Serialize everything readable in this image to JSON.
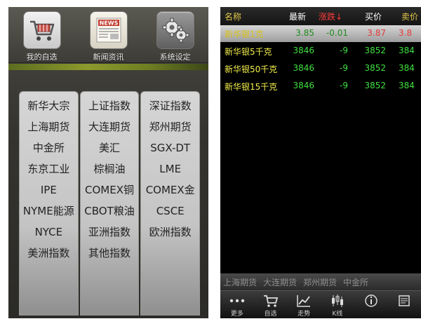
{
  "left": {
    "top_buttons": [
      {
        "label": "我的自选",
        "icon": "shopping-cart-icon"
      },
      {
        "label": "新闻资讯",
        "icon": "newspaper-icon",
        "icon_text": "NEWS"
      },
      {
        "label": "系统设定",
        "icon": "gear-icon"
      }
    ],
    "markets": [
      [
        "新华大宗",
        "上证指数",
        "深证指数"
      ],
      [
        "上海期货",
        "大连期货",
        "郑州期货"
      ],
      [
        "中金所",
        "美汇",
        "SGX-DT"
      ],
      [
        "东京工业",
        "棕榈油",
        "LME"
      ],
      [
        "IPE",
        "COMEX铜",
        "COMEX金"
      ],
      [
        "NYME能源",
        "CBOT粮油",
        "CSCE"
      ],
      [
        "NYCE",
        "亚洲指数",
        "欧洲指数"
      ],
      [
        "美洲指数",
        "其他指数",
        ""
      ]
    ]
  },
  "right": {
    "header": {
      "name": "名称",
      "last": "最新",
      "change": "涨跌↓",
      "bid": "买价",
      "ask": "卖价"
    },
    "rows": [
      {
        "name": "新华银1克",
        "last": "3.85",
        "change": "-0.01",
        "bid": "3.87",
        "ask": "3.8",
        "selected": true
      },
      {
        "name": "新华银5千克",
        "last": "3846",
        "change": "-9",
        "bid": "3852",
        "ask": "384",
        "selected": false
      },
      {
        "name": "新华银50千克",
        "last": "3846",
        "change": "-9",
        "bid": "3852",
        "ask": "384",
        "selected": false
      },
      {
        "name": "新华银15千克",
        "last": "3846",
        "change": "-9",
        "bid": "3852",
        "ask": "384",
        "selected": false
      }
    ],
    "tabs": [
      "上海期货",
      "大连期货",
      "郑州期货",
      "中金所"
    ],
    "nav": [
      {
        "label": "更多",
        "icon": "more-dots-icon"
      },
      {
        "label": "自选",
        "icon": "cart-icon"
      },
      {
        "label": "走势",
        "icon": "trend-line-icon"
      },
      {
        "label": "K线",
        "icon": "candlestick-icon"
      },
      {
        "label": "",
        "icon": "info-icon"
      },
      {
        "label": "",
        "icon": "news-icon"
      }
    ]
  },
  "colors": {
    "quote_green": "#3fe03f",
    "quote_yellow": "#f3ef4b",
    "header_red": "#ff3b3b",
    "accent_olive": "#8c9a2c"
  }
}
